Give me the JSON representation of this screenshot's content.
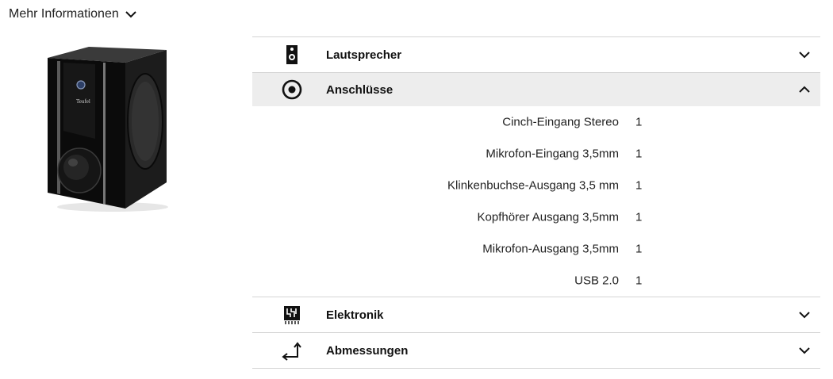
{
  "more_info": {
    "label": "Mehr Informationen",
    "icon": "chevron-down-icon"
  },
  "product": {
    "image_alt": "Teufel Subwoofer",
    "brand_logo": "Teufel"
  },
  "accordion": {
    "sections": [
      {
        "title": "Lautsprecher",
        "icon": "speaker-icon",
        "expanded": false
      },
      {
        "title": "Anschlüsse",
        "icon": "connector-icon",
        "expanded": true,
        "rows": [
          {
            "label": "Cinch-Eingang Stereo",
            "value": "1"
          },
          {
            "label": "Mikrofon-Eingang 3,5mm",
            "value": "1"
          },
          {
            "label": "Klinkenbuchse-Ausgang 3,5 mm",
            "value": "1"
          },
          {
            "label": "Kopfhörer Ausgang 3,5mm",
            "value": "1"
          },
          {
            "label": "Mikrofon-Ausgang 3,5mm",
            "value": "1"
          },
          {
            "label": "USB 2.0",
            "value": "1"
          }
        ]
      },
      {
        "title": "Elektronik",
        "icon": "circuit-icon",
        "expanded": false
      },
      {
        "title": "Abmessungen",
        "icon": "dimensions-icon",
        "expanded": false
      }
    ]
  },
  "colors": {
    "header_open_bg": "#ededed",
    "divider": "#d4d4d4",
    "text": "#111111"
  }
}
